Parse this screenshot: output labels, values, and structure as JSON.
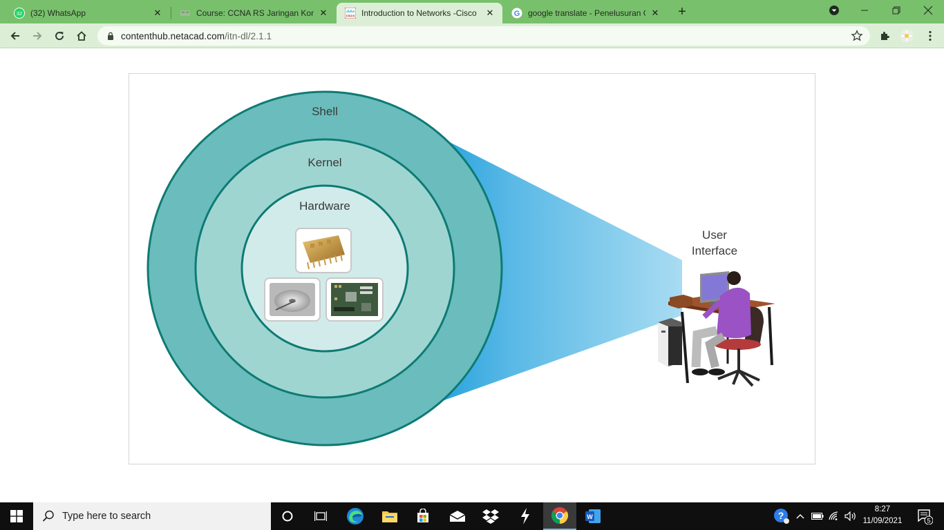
{
  "browser": {
    "tabs": [
      {
        "title": "(32) WhatsApp",
        "badge": "32",
        "active": false
      },
      {
        "title": "Course: CCNA RS Jaringan Komp",
        "active": false
      },
      {
        "title": "Introduction to Networks -Cisco",
        "favicon_text": "cisco",
        "active": true
      },
      {
        "title": "google translate - Penelusuran G",
        "favicon_letter": "G",
        "active": false
      }
    ],
    "new_tab_label": "+",
    "url_host": "contenthub.netacad.com",
    "url_path": "/itn-dl/2.1.1"
  },
  "diagram": {
    "rings": {
      "outer": "Shell",
      "middle": "Kernel",
      "inner": "Hardware"
    },
    "user_interface": "User\nInterface",
    "hardware_icons": [
      "cpu-chip",
      "hard-disk",
      "motherboard"
    ],
    "colors": {
      "outer": "#6abdbc",
      "middle": "#9fd5d1",
      "inner": "#d1ebea",
      "stroke": "#0e7a73",
      "beam_dark": "#2aa3dd",
      "beam_light": "#a8dcf2"
    }
  },
  "taskbar": {
    "search_placeholder": "Type here to search",
    "time": "8:27",
    "date": "11/09/2021",
    "notification_count": "5"
  }
}
